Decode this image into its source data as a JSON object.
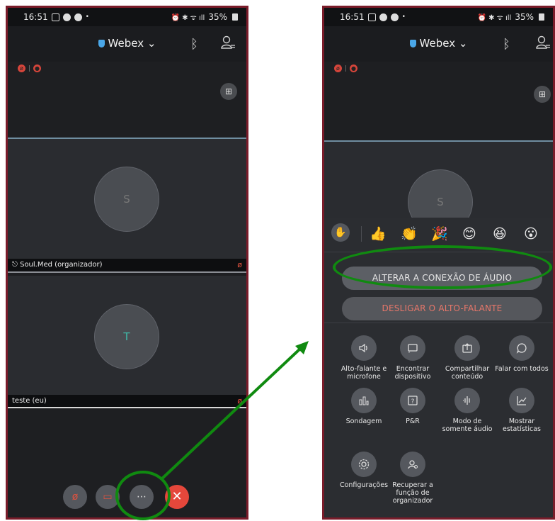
{
  "left": {
    "status": {
      "time": "16:51",
      "battery": "35%"
    },
    "brand": "Webex",
    "tiles": [
      {
        "initial": "S",
        "name": "Soul.Med (organizador)"
      },
      {
        "initial": "T",
        "name": "teste (eu)"
      }
    ],
    "controls": {
      "more_label": "⋯"
    }
  },
  "right": {
    "status": {
      "time": "16:51",
      "battery": "35%"
    },
    "brand": "Webex",
    "tile_initial": "S",
    "reactions": [
      "✋",
      "👍",
      "👏",
      "🎉",
      "😊",
      "😆",
      "😮"
    ],
    "buttons": {
      "change_audio": "ALTERAR A CONEXÃO DE ÁUDIO",
      "speaker_off": "DESLIGAR O ALTO-FALANTE"
    },
    "options": [
      {
        "label": "Alto-falante e microfone",
        "icon": "speaker-icon"
      },
      {
        "label": "Encontrar dispositivo",
        "icon": "cast-icon"
      },
      {
        "label": "Compartilhar conteúdo",
        "icon": "share-icon"
      },
      {
        "label": "Falar com todos",
        "icon": "chat-icon"
      },
      {
        "label": "Sondagem",
        "icon": "poll-icon"
      },
      {
        "label": "P&R",
        "icon": "qa-icon"
      },
      {
        "label": "Modo de somente áudio",
        "icon": "audio-wave-icon"
      },
      {
        "label": "Mostrar estatísticas",
        "icon": "stats-icon"
      },
      {
        "label": "Configurações",
        "icon": "gear-icon"
      },
      {
        "label": "Recuperar a função de organizador",
        "icon": "host-icon"
      }
    ]
  },
  "colors": {
    "annotation": "#108a10",
    "frame": "#7a1c2a",
    "end_call": "#e5473b"
  }
}
